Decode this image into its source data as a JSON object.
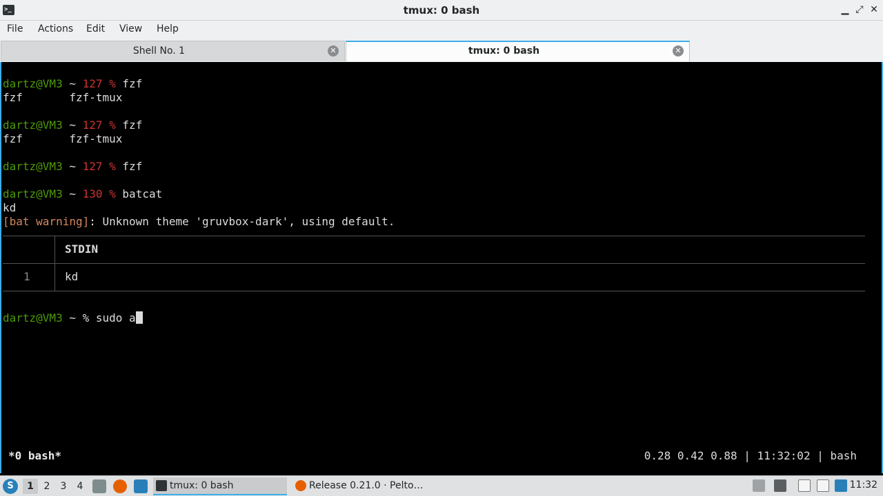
{
  "window": {
    "title": "tmux: 0 bash",
    "minimize": "▁",
    "maximize": "⤢",
    "close": "✕"
  },
  "menu": [
    "File",
    "Actions",
    "Edit",
    "View",
    "Help"
  ],
  "tabs": [
    {
      "label": "Shell No. 1",
      "active": false
    },
    {
      "label": "tmux: 0 bash",
      "active": true
    }
  ],
  "terminal": {
    "lines": [
      {
        "user": "dartz@VM3",
        "sep": " ~ ",
        "code": "127",
        "prompt": " % ",
        "cmd": "fzf"
      },
      {
        "output": "fzf       fzf-tmux"
      },
      {
        "user": "dartz@VM3",
        "sep": " ~ ",
        "code": "127",
        "prompt": " % ",
        "cmd": "fzf"
      },
      {
        "output": "fzf       fzf-tmux"
      },
      {
        "user": "dartz@VM3",
        "sep": " ~ ",
        "code": "127",
        "prompt": " % ",
        "cmd": "fzf"
      },
      {
        "user": "dartz@VM3",
        "sep": " ~ ",
        "code": "130",
        "prompt": " % ",
        "cmd": "batcat"
      },
      {
        "output": "kd"
      }
    ],
    "warning_tag": "[bat warning]",
    "warning_text": ": Unknown theme 'gruvbox-dark', using default.",
    "bat": {
      "header": "STDIN",
      "line_no": "1",
      "line_text": "kd"
    },
    "current": {
      "user": "dartz@VM3",
      "rest": " ~ % sudo a"
    },
    "status_left": "*0 bash*",
    "status_right": "0.28 0.42 0.88 | 11:32:02 | bash"
  },
  "taskbar": {
    "workspaces": [
      "1",
      "2",
      "3",
      "4"
    ],
    "tasks": [
      {
        "label": "tmux: 0 bash",
        "icon": "terminal-icon",
        "active": true
      },
      {
        "label": "Release 0.21.0 · Pelto…",
        "icon": "firefox-icon",
        "active": false
      }
    ],
    "clock": "11:32",
    "colors": {
      "accent": "#3daee9",
      "prompt_user": "#4e9a06",
      "exit_code": "#cc3333",
      "warning": "#d7875f"
    }
  }
}
